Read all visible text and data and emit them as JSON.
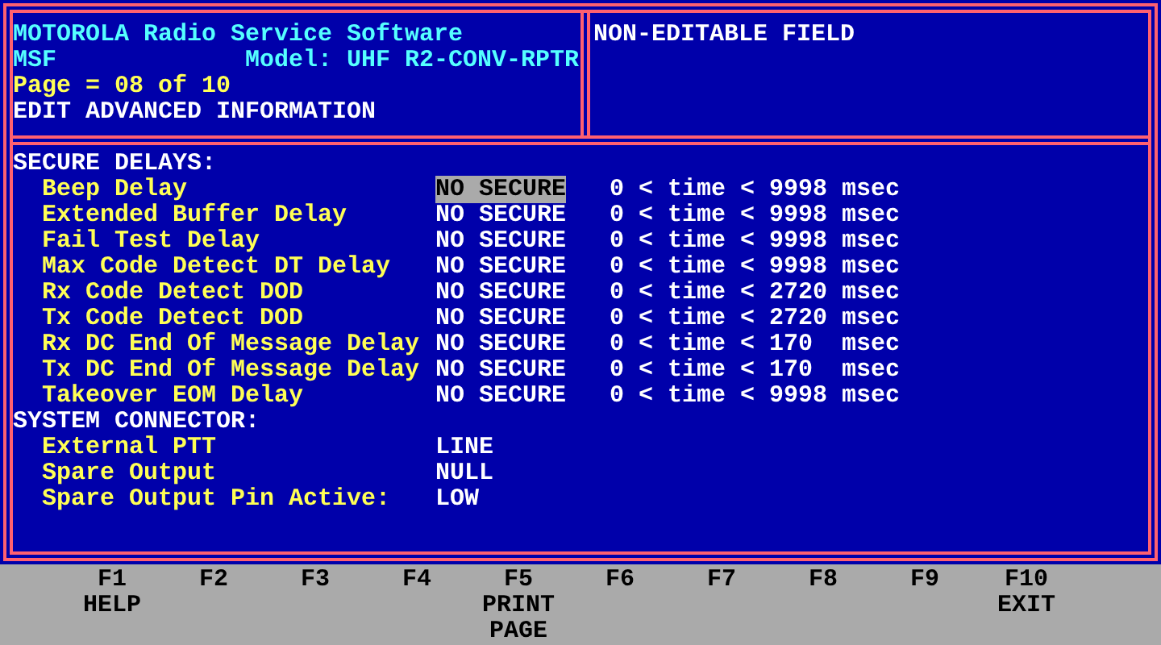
{
  "header": {
    "title": "MOTOROLA Radio Service Software",
    "app": "MSF",
    "model": "Model: UHF R2-CONV-RPTR",
    "page": "Page = 08 of 10",
    "mode": "EDIT ADVANCED INFORMATION"
  },
  "info_field": "NON-EDITABLE FIELD",
  "sections": [
    {
      "heading": "SECURE DELAYS:",
      "rows": [
        {
          "label": "Beep Delay",
          "value": "NO SECURE",
          "selected": true,
          "range": "0 < time < 9998",
          "unit": "msec"
        },
        {
          "label": "Extended Buffer Delay",
          "value": "NO SECURE",
          "selected": false,
          "range": "0 < time < 9998",
          "unit": "msec"
        },
        {
          "label": "Fail Test Delay",
          "value": "NO SECURE",
          "selected": false,
          "range": "0 < time < 9998",
          "unit": "msec"
        },
        {
          "label": "Max Code Detect DT Delay",
          "value": "NO SECURE",
          "selected": false,
          "range": "0 < time < 9998",
          "unit": "msec"
        },
        {
          "label": "Rx Code Detect DOD",
          "value": "NO SECURE",
          "selected": false,
          "range": "0 < time < 2720",
          "unit": "msec"
        },
        {
          "label": "Tx Code Detect DOD",
          "value": "NO SECURE",
          "selected": false,
          "range": "0 < time < 2720",
          "unit": "msec"
        },
        {
          "label": "Rx DC End Of Message Delay",
          "value": "NO SECURE",
          "selected": false,
          "range": "0 < time < 170",
          "unit": "msec"
        },
        {
          "label": "Tx DC End Of Message Delay",
          "value": "NO SECURE",
          "selected": false,
          "range": "0 < time < 170",
          "unit": "msec"
        },
        {
          "label": "Takeover EOM Delay",
          "value": "NO SECURE",
          "selected": false,
          "range": "0 < time < 9998",
          "unit": "msec"
        }
      ]
    },
    {
      "heading": "SYSTEM CONNECTOR:",
      "rows": [
        {
          "label": "External PTT",
          "value": "LINE",
          "selected": false
        },
        {
          "label": "Spare Output",
          "value": "NULL",
          "selected": false
        },
        {
          "label": "Spare Output Pin Active:",
          "value": "LOW",
          "selected": false
        }
      ]
    }
  ],
  "function_keys": [
    {
      "key": "F1",
      "lines": [
        "HELP"
      ]
    },
    {
      "key": "F2"
    },
    {
      "key": "F3"
    },
    {
      "key": "F4"
    },
    {
      "key": "F5",
      "lines": [
        "PRINT",
        "PAGE"
      ]
    },
    {
      "key": "F6"
    },
    {
      "key": "F7"
    },
    {
      "key": "F8"
    },
    {
      "key": "F9"
    },
    {
      "key": "F10",
      "lines": [
        "EXIT"
      ]
    }
  ]
}
